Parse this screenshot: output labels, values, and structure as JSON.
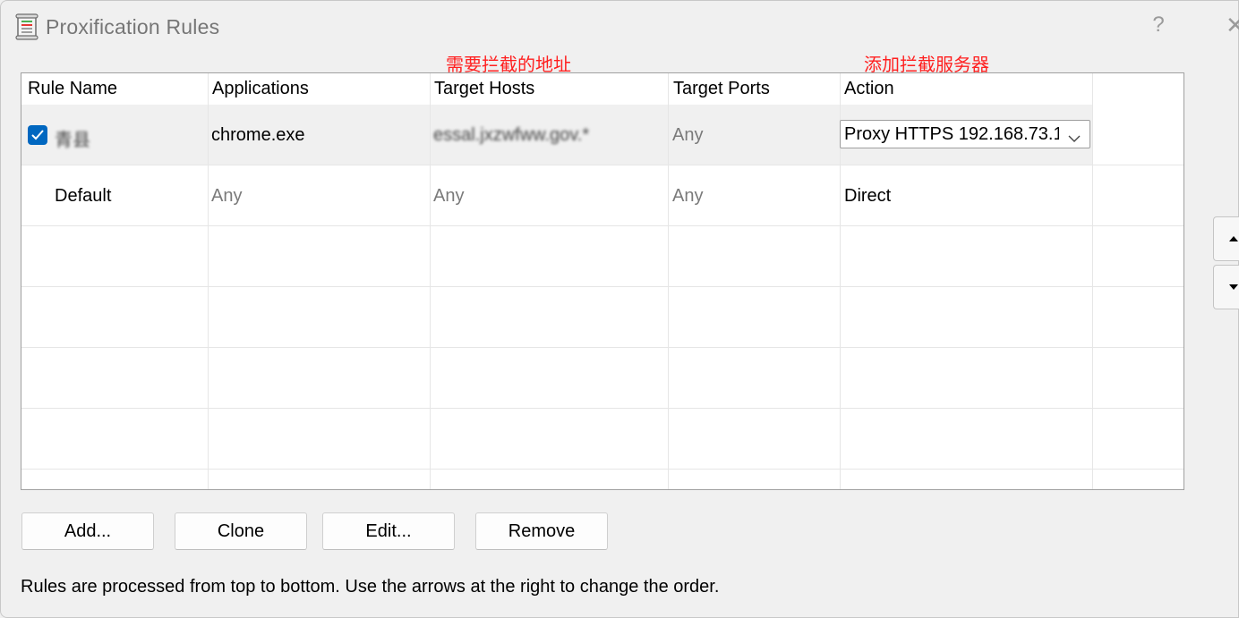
{
  "window": {
    "title": "Proxification Rules",
    "help": "?",
    "close": "✕"
  },
  "annotations": {
    "hosts_note": "需要拦截的地址",
    "action_note": "添加拦截服务器",
    "color": "#ff2020"
  },
  "table": {
    "columns": [
      "Rule Name",
      "Applications",
      "Target Hosts",
      "Target Ports",
      "Action"
    ],
    "rows": [
      {
        "checked": true,
        "name": "青县",
        "applications": "chrome.exe",
        "target_hosts": "essal.jxzwfww.gov.*",
        "target_ports": "Any",
        "action": "Proxy HTTPS 192.168.73.1"
      },
      {
        "checked": null,
        "name": "Default",
        "applications": "Any",
        "target_hosts": "Any",
        "target_ports": "Any",
        "action": "Direct"
      }
    ]
  },
  "buttons": {
    "add": "Add...",
    "clone": "Clone",
    "edit": "Edit...",
    "remove": "Remove"
  },
  "hint": "Rules are processed from top to bottom. Use the arrows at the right to change the order.",
  "colors": {
    "accent": "#0067c0",
    "selected_row": "#f0f0f0"
  }
}
